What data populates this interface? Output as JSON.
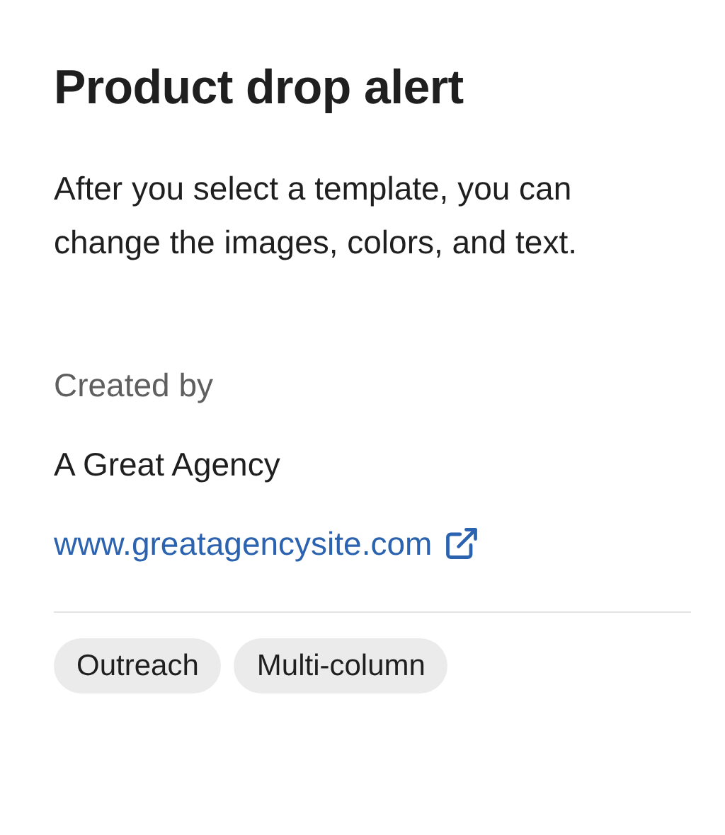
{
  "title": "Product drop alert",
  "description": "After you select a template, you can change the images, colors, and text.",
  "creator": {
    "label": "Created by",
    "name": "A Great Agency",
    "link": "www.greatagencysite.com"
  },
  "tags": [
    "Outreach",
    "Multi-column"
  ]
}
